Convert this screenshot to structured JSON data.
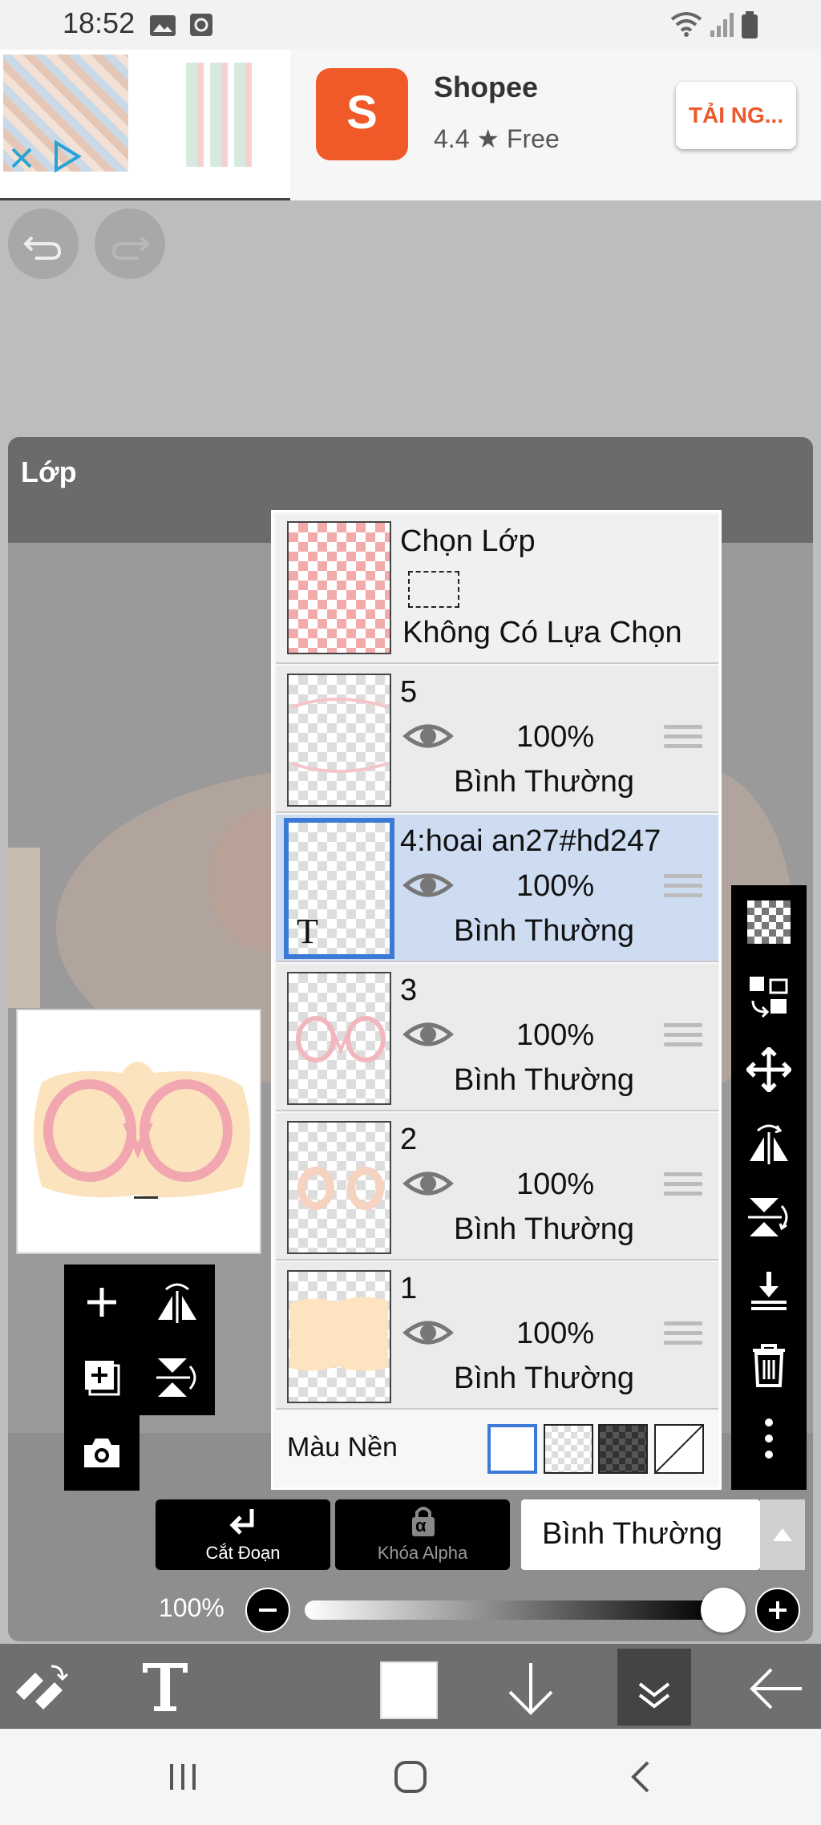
{
  "status_bar": {
    "time": "18:52"
  },
  "ad": {
    "app_name": "Shopee",
    "rating": "4.4 ★ Free",
    "install_button": "TẢI NG...",
    "logo_letter": "S"
  },
  "panel": {
    "title": "Lớp"
  },
  "layer_select": {
    "title": "Chọn Lớp",
    "selection": "Không Có Lựa Chọn"
  },
  "layers": [
    {
      "name": "5",
      "opacity": "100%",
      "blend": "Bình Thường"
    },
    {
      "name": "4:hoai an27#hd247",
      "opacity": "100%",
      "blend": "Bình Thường",
      "selected": true,
      "badge": "T"
    },
    {
      "name": "3",
      "opacity": "100%",
      "blend": "Bình Thường"
    },
    {
      "name": "2",
      "opacity": "100%",
      "blend": "Bình Thường"
    },
    {
      "name": "1",
      "opacity": "100%",
      "blend": "Bình Thường"
    }
  ],
  "background": {
    "label": "Màu Nền"
  },
  "controls": {
    "clipping_label": "Cắt Đoạn",
    "alpha_lock_label": "Khóa Alpha",
    "alpha_symbol": "α",
    "blend_mode": "Bình Thường",
    "opacity_label": "100%",
    "opacity_value": 1.0
  },
  "colors": {
    "accent": "#3b7ad6",
    "selected_row": "#cddcf1",
    "shopee": "#f05a28"
  },
  "icons": {
    "undo": "undo-icon",
    "redo": "redo-icon",
    "add": "plus-icon",
    "text_tool": "text-icon"
  }
}
